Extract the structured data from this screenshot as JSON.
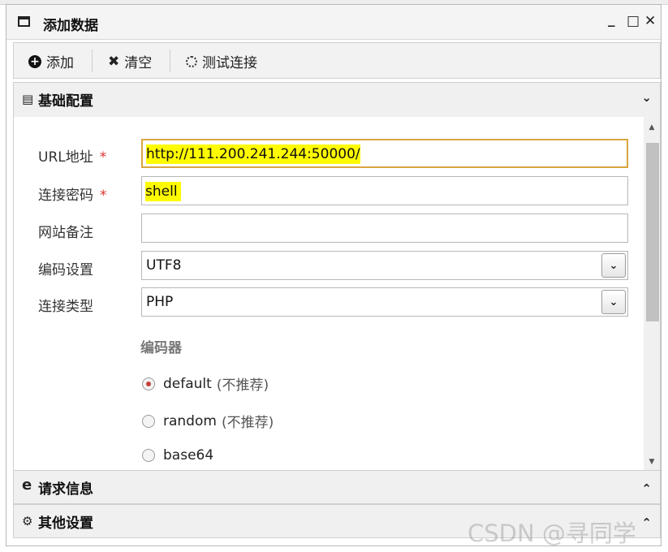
{
  "window": {
    "title": "添加数据",
    "minimize": "_",
    "maximize": "□",
    "close": "✕"
  },
  "toolbar": {
    "add_label": "添加",
    "clear_label": "清空",
    "test_label": "测试连接"
  },
  "sections": {
    "basic": {
      "title": "基础配置",
      "chevron": "v"
    },
    "request": {
      "title": "请求信息",
      "chevron": "^"
    },
    "other": {
      "title": "其他设置",
      "chevron": "^"
    }
  },
  "form": {
    "url": {
      "label": "URL地址",
      "required": "*",
      "value": "http://111.200.241.244:50000/"
    },
    "password": {
      "label": "连接密码",
      "required": "*",
      "value": "shell"
    },
    "note": {
      "label": "网站备注",
      "value": ""
    },
    "encoding": {
      "label": "编码设置",
      "value": "UTF8"
    },
    "type": {
      "label": "连接类型",
      "value": "PHP"
    },
    "encoder_title": "编码器",
    "encoders": [
      {
        "name": "default",
        "desc": "(不推荐)",
        "selected": true
      },
      {
        "name": "random",
        "desc": "(不推荐)",
        "selected": false
      },
      {
        "name": "base64",
        "desc": "",
        "selected": false
      }
    ]
  },
  "watermark": "CSDN @寻同学",
  "colors": {
    "highlight": "#fffb00",
    "required": "#e03030",
    "focus_border": "#d9a640",
    "radio_selected": "#c34040"
  },
  "icons": [
    "window-icon",
    "plus-circle-icon",
    "x-icon",
    "spinner-icon",
    "document-icon",
    "ie-icon",
    "gears-icon",
    "chevron-down-icon",
    "chevron-up-icon"
  ]
}
